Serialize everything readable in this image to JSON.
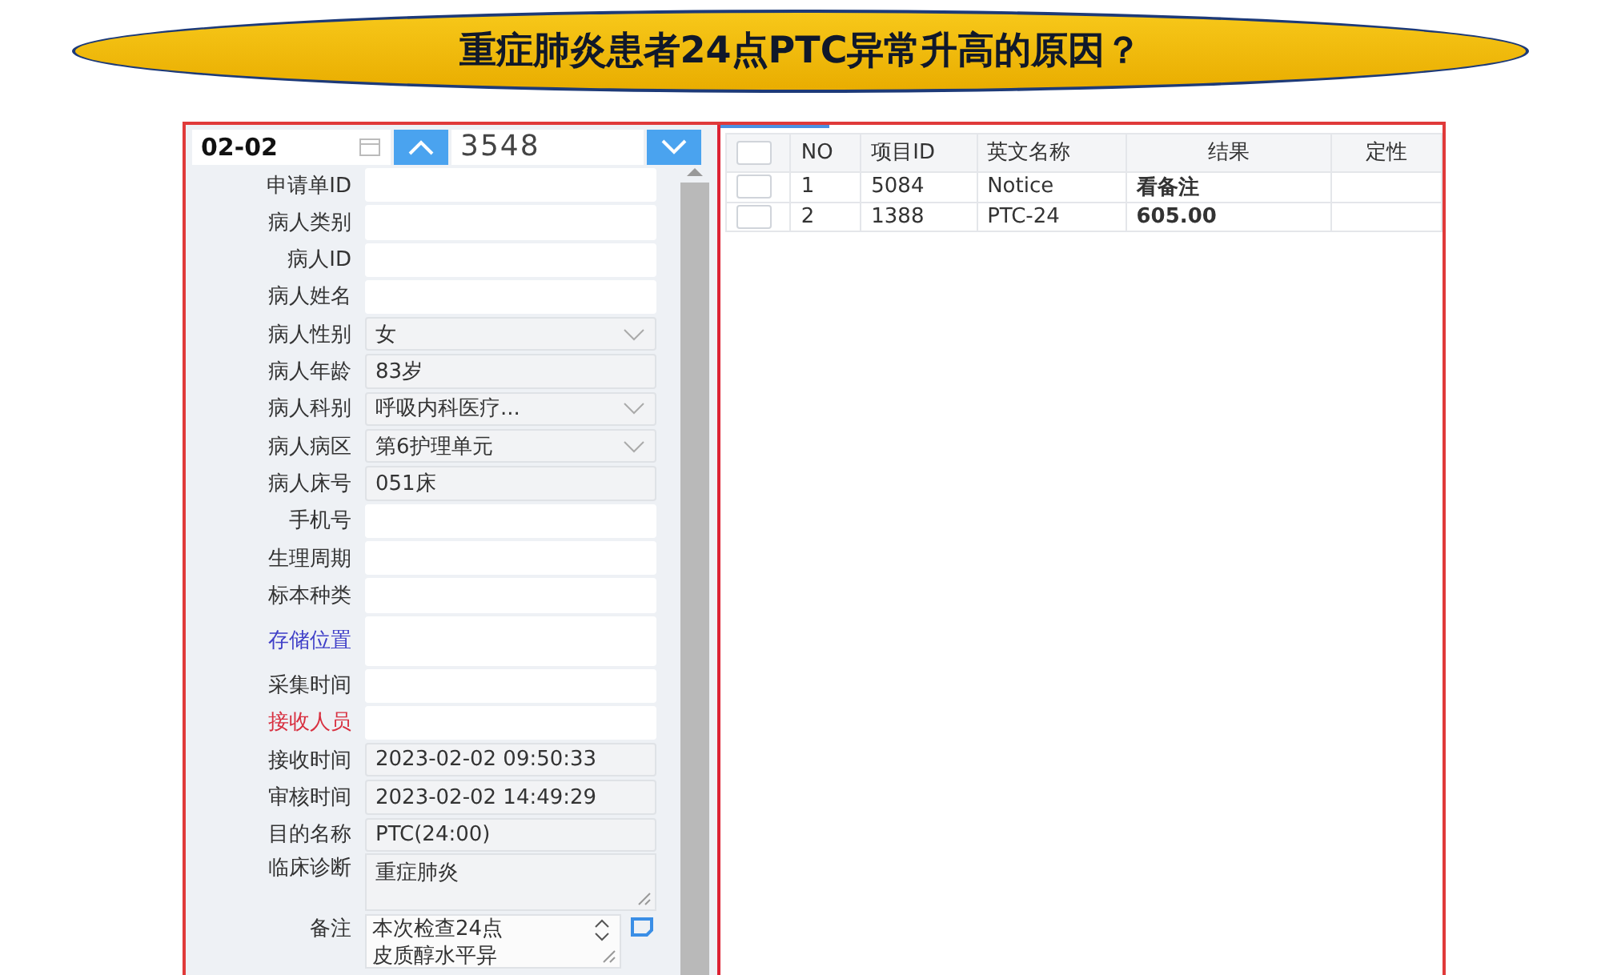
{
  "banner": {
    "title": "重症肺炎患者24点PTC异常升高的原因？"
  },
  "query": {
    "date": "02-02",
    "number": "3548"
  },
  "fields": [
    {
      "label": "申请单ID",
      "kind": "blank",
      "color": "#333333"
    },
    {
      "label": "病人类别",
      "kind": "blank",
      "color": "#333333"
    },
    {
      "label": "病人ID",
      "kind": "blank",
      "color": "#333333"
    },
    {
      "label": "病人姓名",
      "kind": "blank",
      "color": "#333333"
    },
    {
      "label": "病人性别",
      "kind": "select",
      "value": "女",
      "color": "#333333"
    },
    {
      "label": "病人年龄",
      "kind": "text",
      "value": "83岁",
      "color": "#333333"
    },
    {
      "label": "病人科别",
      "kind": "select",
      "value": "呼吸内科医疗...",
      "color": "#333333"
    },
    {
      "label": "病人病区",
      "kind": "select",
      "value": "第6护理单元",
      "color": "#333333"
    },
    {
      "label": "病人床号",
      "kind": "text",
      "value": "051床",
      "color": "#333333"
    },
    {
      "label": "手机号",
      "kind": "blank",
      "color": "#333333"
    },
    {
      "label": "生理周期",
      "kind": "blank",
      "color": "#333333"
    },
    {
      "label": "标本种类",
      "kind": "blank",
      "color": "#333333"
    },
    {
      "label": "存储位置",
      "kind": "tallblank",
      "color": "#4040c8"
    },
    {
      "label": "采集时间",
      "kind": "blank",
      "color": "#333333"
    },
    {
      "label": "接收人员",
      "kind": "blank",
      "color": "#d83040"
    },
    {
      "label": "接收时间",
      "kind": "text",
      "value": "2023-02-02 09:50:33",
      "color": "#333333"
    },
    {
      "label": "审核时间",
      "kind": "text",
      "value": "2023-02-02 14:49:29",
      "color": "#333333"
    },
    {
      "label": "目的名称",
      "kind": "text",
      "value": "PTC(24:00)",
      "color": "#333333"
    },
    {
      "label": "临床诊断",
      "kind": "textarea",
      "value": "重症肺炎",
      "color": "#333333"
    },
    {
      "label": "备注",
      "kind": "remark",
      "lines": [
        "本次检查24点",
        "皮质醇水平异"
      ],
      "color": "#333333"
    }
  ],
  "table": {
    "all_checked": false,
    "columns": [
      "NO",
      "项目ID",
      "英文名称",
      "结果",
      "定性"
    ],
    "rows": [
      {
        "checked": false,
        "cells": [
          "1",
          "5084",
          "Notice",
          "看备注",
          ""
        ]
      },
      {
        "checked": false,
        "cells": [
          "2",
          "1388",
          "PTC-24",
          "605.00",
          ""
        ]
      }
    ]
  }
}
